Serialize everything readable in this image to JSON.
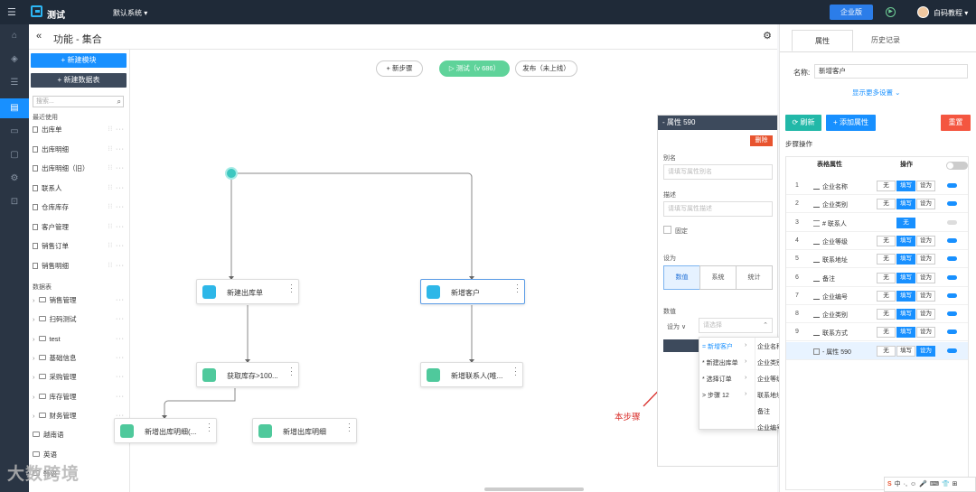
{
  "topbar": {
    "app_title": "测试",
    "system": "默认系统 ▾",
    "enterprise": "企业版",
    "user": "白码教程 ▾"
  },
  "header": {
    "title": "功能 - 集合"
  },
  "sidebar": {
    "new_module": "+ 新建模块",
    "new_table": "+ 新建数据表",
    "search_placeholder": "搜索...",
    "recent_label": "最近使用",
    "recent": [
      "出库单",
      "出库明细",
      "出库明细（旧）",
      "联系人",
      "仓库库存",
      "客户管理",
      "销售订单",
      "销售明细"
    ],
    "tables_label": "数据表",
    "folders": [
      "销售管理",
      "扫码测试",
      "test",
      "基础信息",
      "采购管理",
      "库存管理",
      "财务管理"
    ],
    "extra": [
      "越南语",
      "英语",
      "韩语"
    ]
  },
  "toolbar": {
    "new_step": "+ 新步骤",
    "test": "▷ 测试（v 686）",
    "publish": "发布（未上线）"
  },
  "nodes": {
    "n1": "新建出库单",
    "n2": "新增客户",
    "n3": "获取库存>100...",
    "n4": "新增联系人(唯...",
    "n5": "新增出库明细(...",
    "n6": "新增出库明细"
  },
  "prop_panel": {
    "title": "- 属性 590",
    "delete": "删除",
    "alias_label": "别名",
    "alias_placeholder": "请填写属性别名",
    "desc_label": "描述",
    "desc_placeholder": "请填写属性描述",
    "fixed": "固定",
    "set_label": "设为",
    "seg": [
      "数值",
      "系统",
      "统计"
    ],
    "value_label": "数值",
    "set_as": "设为 ∨",
    "select_placeholder": "请选择"
  },
  "dropdown": {
    "col1": [
      "= 新增客户",
      "* 新建出库单",
      "* 选择订单",
      "> 步骤 12"
    ],
    "col2": [
      "企业名称",
      "企业类别",
      "企业等级",
      "联系地址",
      "备注",
      "企业编号"
    ]
  },
  "annotation": "本步骤",
  "right_panel": {
    "tabs": [
      "属性",
      "历史记录"
    ],
    "name_label": "名称:",
    "name_value": "新增客户",
    "more": "显示更多设置 ⌄",
    "refresh": "⟳ 刷新",
    "add_attr": "+ 添加属性",
    "reset": "重置",
    "step_ops": "步骤操作",
    "col_attr": "表格属性",
    "col_op": "操作",
    "rows": [
      {
        "n": "1",
        "name": "企业名称",
        "b1": "无",
        "b2": "填写",
        "b3": "设为"
      },
      {
        "n": "2",
        "name": "企业类别",
        "b1": "无",
        "b2": "填写",
        "b3": "设为"
      },
      {
        "n": "3",
        "name": "# 联系人",
        "b1": "",
        "b2": "无",
        "b3": ""
      },
      {
        "n": "4",
        "name": "企业等级",
        "b1": "无",
        "b2": "填写",
        "b3": "设为"
      },
      {
        "n": "5",
        "name": "联系地址",
        "b1": "无",
        "b2": "填写",
        "b3": "设为"
      },
      {
        "n": "6",
        "name": "备注",
        "b1": "无",
        "b2": "填写",
        "b3": "设为"
      },
      {
        "n": "7",
        "name": "企业编号",
        "b1": "无",
        "b2": "填写",
        "b3": "设为"
      },
      {
        "n": "8",
        "name": "企业类别",
        "b1": "无",
        "b2": "填写",
        "b3": "设为"
      },
      {
        "n": "9",
        "name": "联系方式",
        "b1": "无",
        "b2": "填写",
        "b3": "设为"
      },
      {
        "n": "",
        "name": "- 属性 590",
        "b1": "无",
        "b2": "填写",
        "b3": "设为"
      }
    ]
  },
  "ime": [
    "S",
    "中",
    "·,",
    "☺",
    "🎤",
    "⌨",
    "👕",
    "⊞"
  ],
  "watermark": "大数跨境"
}
